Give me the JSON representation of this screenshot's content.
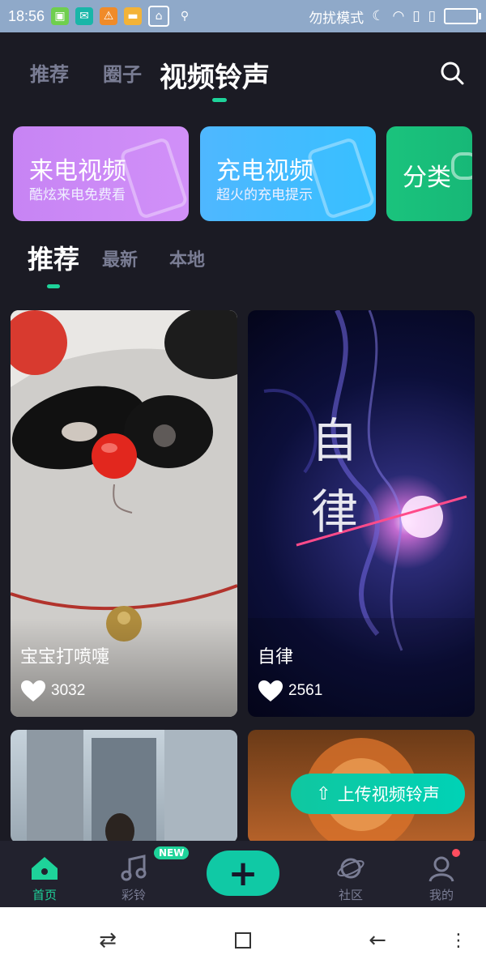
{
  "status_bar": {
    "time": "18:56",
    "mode": "勿扰模式"
  },
  "top_tabs": [
    {
      "label": "推荐",
      "active": false
    },
    {
      "label": "圈子",
      "active": false
    },
    {
      "label": "视频铃声",
      "active": true
    }
  ],
  "feature_cards": [
    {
      "title": "来电视频",
      "subtitle": "酷炫来电免费看",
      "color": "#c47df0"
    },
    {
      "title": "充电视频",
      "subtitle": "超火的充电提示",
      "color": "#3fb4ff"
    },
    {
      "title": "分类",
      "subtitle": "",
      "color": "#1ac37d"
    }
  ],
  "sub_tabs": [
    {
      "label": "推荐",
      "active": true
    },
    {
      "label": "最新",
      "active": false
    },
    {
      "label": "本地",
      "active": false
    }
  ],
  "videos": [
    {
      "title": "宝宝打喷嚏",
      "likes": "3032"
    },
    {
      "title": "自律",
      "likes": "2561",
      "poster_text": "自律"
    }
  ],
  "upload_button": {
    "label": "上传视频铃声"
  },
  "bottom_nav": [
    {
      "label": "首页",
      "active": true
    },
    {
      "label": "彩铃",
      "active": false,
      "badge": "NEW"
    },
    {
      "label": "",
      "active": false
    },
    {
      "label": "社区",
      "active": false
    },
    {
      "label": "我的",
      "active": false
    }
  ],
  "colors": {
    "accent": "#1ed39a",
    "background": "#1b1b24"
  }
}
